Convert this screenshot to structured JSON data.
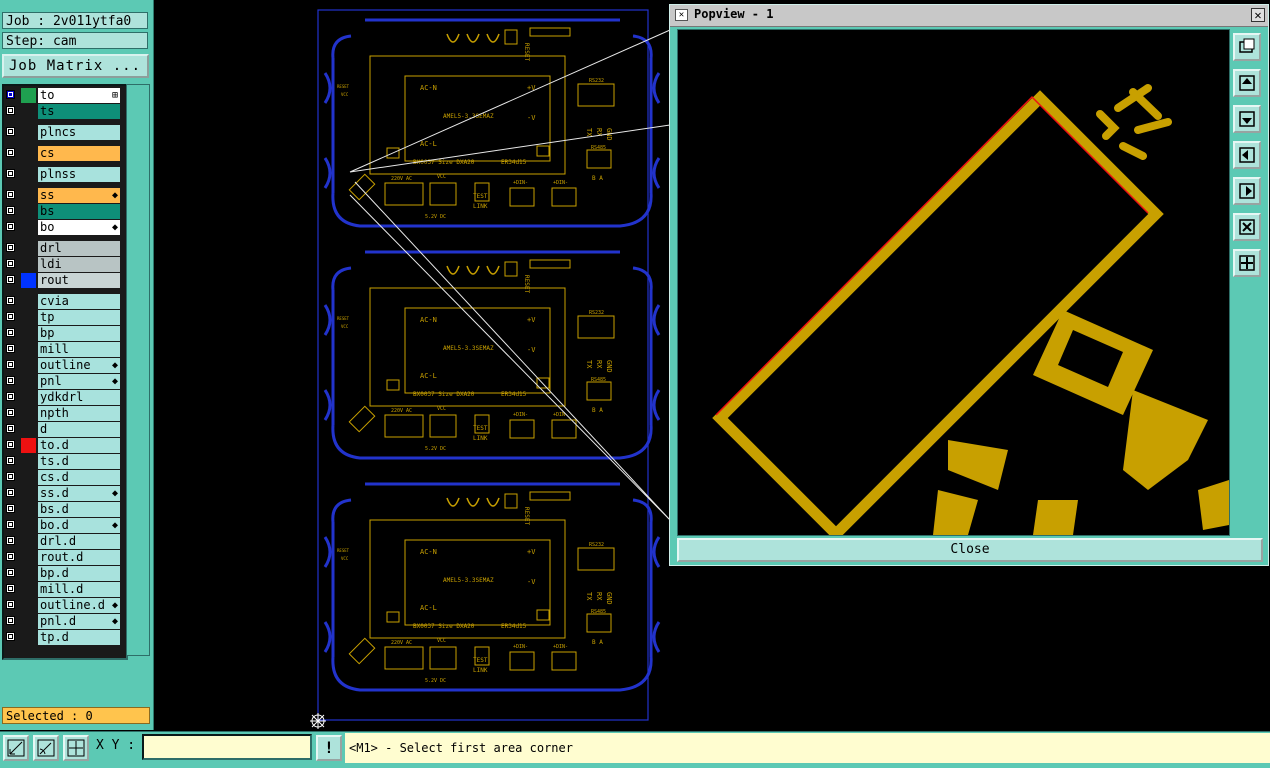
{
  "job": {
    "label": "Job : 2v011ytfa0",
    "step": "Step: cam",
    "matrix_button": "Job Matrix ..."
  },
  "layers": [
    {
      "name": "to",
      "color": "#1fa050",
      "label_bg": "#ffffff",
      "selected": true,
      "mark": "⊞"
    },
    {
      "name": "ts",
      "color": "#1a1a1a",
      "label_bg": "#0e8f78",
      "selected": false,
      "mark": ""
    },
    {
      "name": "plncs",
      "color": "#1a1a1a",
      "label_bg": "#a8e2dd",
      "selected": false,
      "mark": ""
    },
    {
      "name": "cs",
      "color": "#1a1a1a",
      "label_bg": "#ffb84d",
      "selected": false,
      "mark": ""
    },
    {
      "name": "plnss",
      "color": "#1a1a1a",
      "label_bg": "#a8e2dd",
      "selected": false,
      "mark": ""
    },
    {
      "name": "ss",
      "color": "#1a1a1a",
      "label_bg": "#ffb84d",
      "selected": false,
      "mark": "◆"
    },
    {
      "name": "bs",
      "color": "#1a1a1a",
      "label_bg": "#0e8f78",
      "selected": false,
      "mark": ""
    },
    {
      "name": "bo",
      "color": "#1a1a1a",
      "label_bg": "#ffffff",
      "selected": false,
      "mark": "◆"
    },
    {
      "name": "drl",
      "color": "#1a1a1a",
      "label_bg": "#b8c4c4",
      "selected": false,
      "mark": ""
    },
    {
      "name": "ldi",
      "color": "#1a1a1a",
      "label_bg": "#b8c4c4",
      "selected": false,
      "mark": ""
    },
    {
      "name": "rout",
      "color": "#0033ff",
      "label_bg": "#c8d4d4",
      "selected": false,
      "mark": ""
    },
    {
      "name": "cvia",
      "color": "#1a1a1a",
      "label_bg": "#a8e2dd",
      "selected": false,
      "mark": ""
    },
    {
      "name": "tp",
      "color": "#1a1a1a",
      "label_bg": "#a8e2dd",
      "selected": false,
      "mark": ""
    },
    {
      "name": "bp",
      "color": "#1a1a1a",
      "label_bg": "#a8e2dd",
      "selected": false,
      "mark": ""
    },
    {
      "name": "mill",
      "color": "#1a1a1a",
      "label_bg": "#a8e2dd",
      "selected": false,
      "mark": ""
    },
    {
      "name": "outline",
      "color": "#1a1a1a",
      "label_bg": "#a8e2dd",
      "selected": false,
      "mark": "◆"
    },
    {
      "name": "pnl",
      "color": "#1a1a1a",
      "label_bg": "#a8e2dd",
      "selected": false,
      "mark": "◆"
    },
    {
      "name": "ydkdrl",
      "color": "#1a1a1a",
      "label_bg": "#a8e2dd",
      "selected": false,
      "mark": ""
    },
    {
      "name": "npth",
      "color": "#1a1a1a",
      "label_bg": "#a8e2dd",
      "selected": false,
      "mark": ""
    },
    {
      "name": "d",
      "color": "#1a1a1a",
      "label_bg": "#a8e2dd",
      "selected": false,
      "mark": ""
    },
    {
      "name": "to.d",
      "color": "#ee1111",
      "label_bg": "#a8e2dd",
      "selected": false,
      "mark": ""
    },
    {
      "name": "ts.d",
      "color": "#1a1a1a",
      "label_bg": "#a8e2dd",
      "selected": false,
      "mark": ""
    },
    {
      "name": "cs.d",
      "color": "#1a1a1a",
      "label_bg": "#a8e2dd",
      "selected": false,
      "mark": ""
    },
    {
      "name": "ss.d",
      "color": "#1a1a1a",
      "label_bg": "#a8e2dd",
      "selected": false,
      "mark": "◆"
    },
    {
      "name": "bs.d",
      "color": "#1a1a1a",
      "label_bg": "#a8e2dd",
      "selected": false,
      "mark": ""
    },
    {
      "name": "bo.d",
      "color": "#1a1a1a",
      "label_bg": "#a8e2dd",
      "selected": false,
      "mark": "◆"
    },
    {
      "name": "drl.d",
      "color": "#1a1a1a",
      "label_bg": "#a8e2dd",
      "selected": false,
      "mark": ""
    },
    {
      "name": "rout.d",
      "color": "#1a1a1a",
      "label_bg": "#a8e2dd",
      "selected": false,
      "mark": ""
    },
    {
      "name": "bp.d",
      "color": "#1a1a1a",
      "label_bg": "#a8e2dd",
      "selected": false,
      "mark": ""
    },
    {
      "name": "mill.d",
      "color": "#1a1a1a",
      "label_bg": "#a8e2dd",
      "selected": false,
      "mark": ""
    },
    {
      "name": "outline.d",
      "color": "#1a1a1a",
      "label_bg": "#a8e2dd",
      "selected": false,
      "mark": "◆"
    },
    {
      "name": "pnl.d",
      "color": "#1a1a1a",
      "label_bg": "#a8e2dd",
      "selected": false,
      "mark": "◆"
    },
    {
      "name": "tp.d",
      "color": "#1a1a1a",
      "label_bg": "#a8e2dd",
      "selected": false,
      "mark": ""
    }
  ],
  "selected_label": "Selected : 0",
  "popview": {
    "title": "Popview - 1",
    "close_label": "Close",
    "close_x": "✕"
  },
  "board": {
    "module_name": "AMEL5-3.3SEMAZ",
    "box_label": "BX0037 Size DXA20",
    "part_code": "ER34d15",
    "ac_n": "AC-N",
    "ac_l": "AC-L",
    "pos_v": "+V",
    "neg_v": "-V",
    "test": "TEST",
    "link": "LINK",
    "tx": "TX",
    "rx": "RX",
    "gnd": "GND",
    "rs232": "RS232",
    "rs485": "RS485",
    "ac220": "220V AC",
    "vcc": "VCC",
    "dc": "5.2V DC",
    "din": "+DIN-",
    "reset": "RESET",
    "j1": "J1",
    "ba": "BA",
    "e": "E"
  },
  "bottom": {
    "xy_label": "X Y :",
    "xy_value": "",
    "status": "<M1> - Select first area corner",
    "alert_label": "!"
  },
  "colors": {
    "panel": "#5cc9b4",
    "silk": "#c8a000",
    "rout": "#2233cc",
    "highlight": "#ffb84d"
  }
}
